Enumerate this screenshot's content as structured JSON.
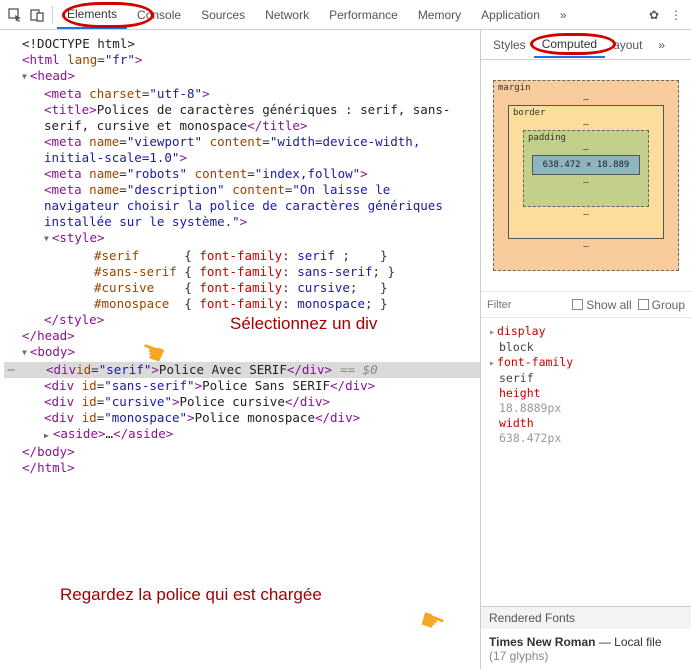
{
  "topTabs": {
    "elements": "Elements",
    "console": "Console",
    "sources": "Sources",
    "network": "Network",
    "performance": "Performance",
    "memory": "Memory",
    "application": "Application",
    "more": "»"
  },
  "dom": {
    "doctype": "<!DOCTYPE html>",
    "htmlOpen": {
      "tag": "html",
      "attr": "lang",
      "val": "\"fr\""
    },
    "headOpen": "head",
    "metaCharset": {
      "tag": "meta",
      "attr": "charset",
      "val": "\"utf-8\""
    },
    "title": {
      "open": "title",
      "text": "Polices de caractères génériques : serif, sans-serif, cursive et monospace",
      "close": "title"
    },
    "metaViewport": {
      "attr1": "name",
      "val1": "\"viewport\"",
      "attr2": "content",
      "val2": "\"width=device-width, initial-scale=1.0\""
    },
    "metaRobots": {
      "attr1": "name",
      "val1": "\"robots\"",
      "attr2": "content",
      "val2": "\"index,follow\""
    },
    "metaDesc": {
      "attr1": "name",
      "val1": "\"description\"",
      "attr2": "content",
      "val2": "\"On laisse le navigateur choisir la police de caractères génériques installée sur le système.\""
    },
    "styleOpen": "style",
    "css": {
      "s1": "#serif",
      "p1": "font-family",
      "v1": "serif",
      "s2": "#sans-serif",
      "p2": "font-family",
      "v2": "sans-serif",
      "s3": "#cursive",
      "p3": "font-family",
      "v3": "cursive",
      "s4": "#monospace",
      "p4": "font-family",
      "v4": "monospace"
    },
    "styleClose": "style",
    "headClose": "head",
    "bodyOpen": "body",
    "selDiv": {
      "attr": "id",
      "val": "\"serif\"",
      "text": "Police Avec SERIF",
      "suffix": "== $0"
    },
    "div2": {
      "val": "\"sans-serif\"",
      "text": "Police Sans SERIF"
    },
    "div3": {
      "val": "\"cursive\"",
      "text": "Police cursive"
    },
    "div4": {
      "val": "\"monospace\"",
      "text": "Police monospace"
    },
    "aside": "aside",
    "bodyClose": "body",
    "htmlClose": "html"
  },
  "annot": {
    "top": "Sélectionnez un div",
    "bottom": "Regardez la police qui est chargée"
  },
  "rightTabs": {
    "styles": "Styles",
    "computed": "Computed",
    "layout": "ayout",
    "more": "»"
  },
  "boxModel": {
    "margin": "margin",
    "border": "border",
    "padding": "padding",
    "dash": "–",
    "content": "638.472 × 18.889"
  },
  "filter": {
    "placeholder": "Filter",
    "showAll": "Show all",
    "group": "Group"
  },
  "computed": {
    "display": {
      "name": "display",
      "val": "block"
    },
    "fontFamily": {
      "name": "font-family",
      "val": "serif"
    },
    "height": {
      "name": "height",
      "val": "18.8889px"
    },
    "width": {
      "name": "width",
      "val": "638.472px"
    }
  },
  "renderedFonts": {
    "title": "Rendered Fonts",
    "name": "Times New Roman",
    "dash": " — ",
    "src": "Local file",
    "glyphs": "(17 glyphs)"
  }
}
